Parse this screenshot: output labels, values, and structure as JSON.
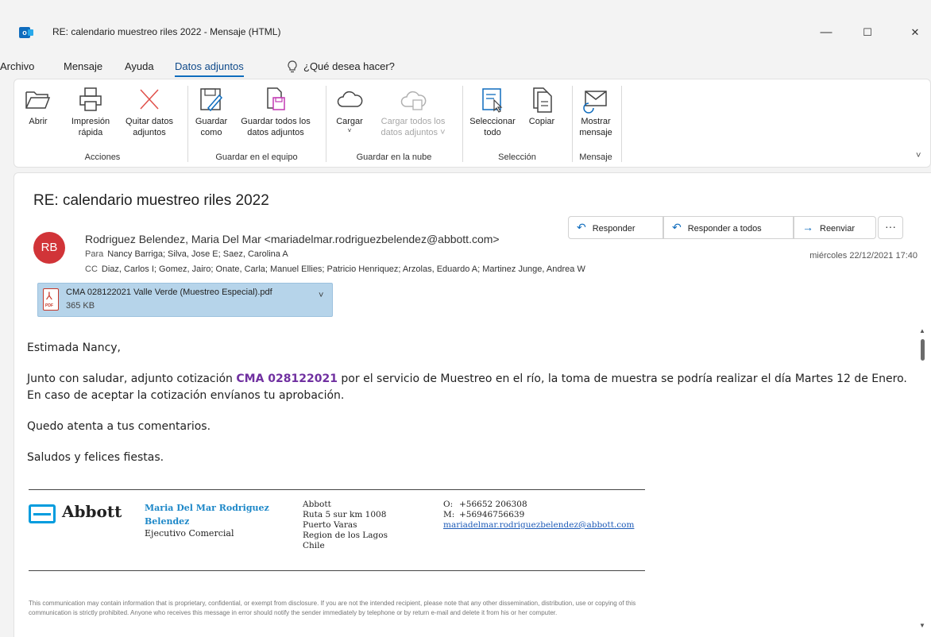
{
  "window": {
    "title": "RE: calendario muestreo riles 2022  -  Mensaje (HTML)",
    "app_icon_letter": "o",
    "minimize": "—",
    "maximize": "☐",
    "close": "✕"
  },
  "menu": {
    "items": [
      "Archivo",
      "Mensaje",
      "Ayuda",
      "Datos adjuntos"
    ],
    "active": "Datos adjuntos",
    "search_hint": "¿Qué desea hacer?"
  },
  "ribbon": {
    "groups": [
      {
        "label": "Acciones",
        "buttons": [
          {
            "line1": "Abrir",
            "line2": ""
          },
          {
            "line1": "Impresión",
            "line2": "rápida"
          },
          {
            "line1": "Quitar datos",
            "line2": "adjuntos"
          }
        ]
      },
      {
        "label": "Guardar en el equipo",
        "buttons": [
          {
            "line1": "Guardar",
            "line2": "como"
          },
          {
            "line1": "Guardar todos los",
            "line2": "datos adjuntos"
          }
        ]
      },
      {
        "label": "Guardar en la nube",
        "buttons": [
          {
            "line1": "Cargar",
            "line2": "˅"
          },
          {
            "line1": "Cargar todos los",
            "line2": "datos adjuntos ˅"
          }
        ]
      },
      {
        "label": "Selección",
        "buttons": [
          {
            "line1": "Seleccionar",
            "line2": "todo"
          },
          {
            "line1": "Copiar",
            "line2": ""
          }
        ]
      },
      {
        "label": "Mensaje",
        "buttons": [
          {
            "line1": "Mostrar",
            "line2": "mensaje"
          }
        ]
      }
    ],
    "expand": "˅"
  },
  "message": {
    "subject": "RE: calendario muestreo riles 2022",
    "avatar_initials": "RB",
    "from": "Rodriguez Belendez, Maria Del Mar <mariadelmar.rodriguezbelendez@abbott.com>",
    "to_label": "Para",
    "to": "Nancy Barriga; Silva, Jose E; Saez, Carolina A",
    "cc_label": "CC",
    "cc": "Diaz, Carlos I; Gomez, Jairo; Onate, Carla; Manuel Ellies; Patricio Henriquez; Arzolas, Eduardo A; Martinez Junge, Andrea W",
    "date": "miércoles 22/12/2021 17:40",
    "actions": {
      "reply": "Responder",
      "reply_all": "Responder a todos",
      "forward": "Reenviar",
      "more": "···"
    },
    "attachment": {
      "name": "CMA 028122021 Valle Verde (Muestreo Especial).pdf",
      "size": "365 KB",
      "icon_tag": "PDF"
    },
    "body": {
      "greeting": "Estimada Nancy,",
      "p1_before": "Junto con saludar, adjunto cotización ",
      "p1_ref": "CMA 028122021",
      "p1_after": " por el servicio de Muestreo en el río, la toma de muestra se podría realizar el día Martes 12 de Enero. En caso de aceptar la cotización envíanos tu aprobación.",
      "p2": "Quedo atenta a tus comentarios.",
      "p3": "Saludos y felices fiestas."
    },
    "signature": {
      "company": "Abbott",
      "name": "Maria Del Mar Rodriguez Belendez",
      "role": "Ejecutivo Comercial",
      "address": [
        "Abbott",
        "Ruta 5 sur km 1008",
        "Puerto Varas",
        "Region de los Lagos",
        "Chile"
      ],
      "office_label": "O:",
      "office": "+56652 206308",
      "mobile_label": "M:",
      "mobile": "+56946756639",
      "email": "mariadelmar.rodriguezbelendez@abbott.com"
    },
    "disclaimer": "This communication may contain information that is proprietary, confidential, or exempt from disclosure. If you are not the intended recipient, please note that any other dissemination, distribution, use or copying of this communication is strictly prohibited. Anyone who receives this message in error should notify the sender immediately by telephone or by return e-mail and delete it from his or her computer."
  },
  "colors": {
    "accent": "#0f6cbd",
    "avatar": "#d13438",
    "reference": "#7030a0",
    "attachment_bg": "#b6d4ea"
  }
}
